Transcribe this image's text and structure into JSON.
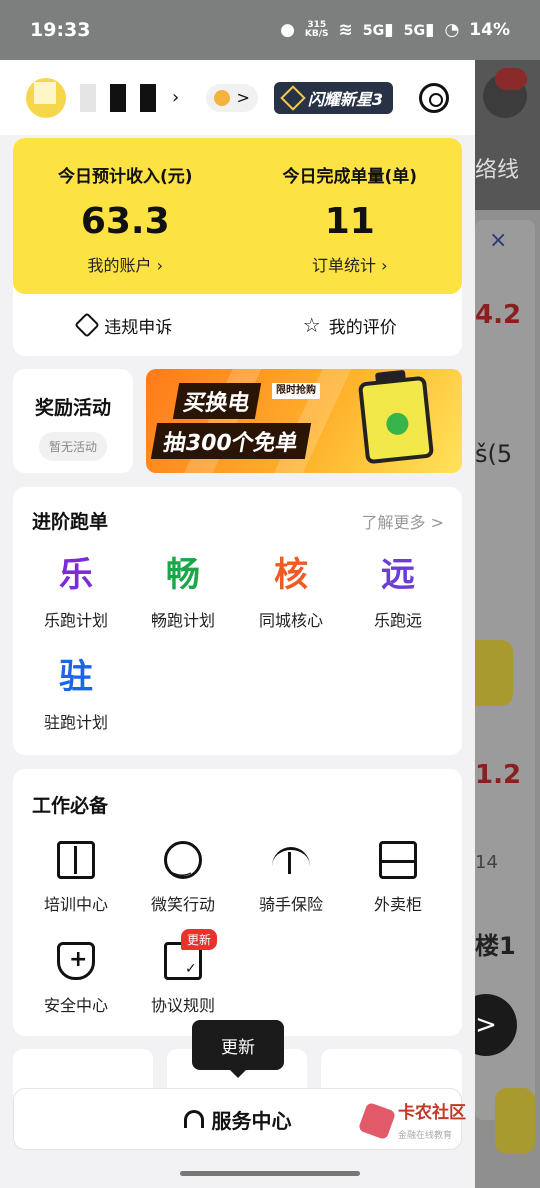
{
  "status_bar": {
    "time": "19:33",
    "net_speed_value": "315",
    "net_speed_unit": "KB/S",
    "battery": "14%",
    "sim1": "5G",
    "sim2": "5G"
  },
  "header": {
    "level_arrow": ">",
    "star_badge": "闪耀新星3"
  },
  "earnings": {
    "income_label": "今日预计收入(元)",
    "income_value": "63.3",
    "account_link": "我的账户",
    "orders_label": "今日完成单量(单)",
    "orders_value": "11",
    "orders_link": "订单统计",
    "complaint": "违规申诉",
    "my_reviews": "我的评价"
  },
  "rewards": {
    "title": "奖励活动",
    "empty": "暂无活动",
    "banner_line1": "买换电",
    "banner_tag": "限时抢购",
    "banner_line2": "抽300个免单"
  },
  "advanced": {
    "title": "进阶跑单",
    "more": "了解更多 >",
    "items": [
      {
        "char": "乐",
        "label": "乐跑计划",
        "color": "#7b2cd6"
      },
      {
        "char": "畅",
        "label": "畅跑计划",
        "color": "#1aa74a"
      },
      {
        "char": "核",
        "label": "同城核心",
        "color": "#f05a23"
      },
      {
        "char": "远",
        "label": "乐跑远",
        "color": "#6b3cd8"
      },
      {
        "char": "驻",
        "label": "驻跑计划",
        "color": "#1c66e5"
      }
    ]
  },
  "essentials": {
    "title": "工作必备",
    "items": [
      {
        "icon": "book-icon",
        "label": "培训中心"
      },
      {
        "icon": "smile-icon",
        "label": "微笑行动"
      },
      {
        "icon": "umbrella-icon",
        "label": "骑手保险"
      },
      {
        "icon": "locker-icon",
        "label": "外卖柜"
      },
      {
        "icon": "shield-plus-icon",
        "label": "安全中心"
      },
      {
        "icon": "document-check-icon",
        "label": "协议规则"
      }
    ],
    "new_badge": "更新"
  },
  "tooltip": "更新",
  "service_center": "服务中心",
  "watermark": {
    "text": "卡农社区",
    "sub": "金融在线教育"
  },
  "background_app": {
    "title": "络线",
    "close": "×",
    "num1": "4.2",
    "text1": "š(5",
    "num2": "1.2",
    "text2": "14",
    "text3": "楼1",
    "arrow": ">"
  }
}
